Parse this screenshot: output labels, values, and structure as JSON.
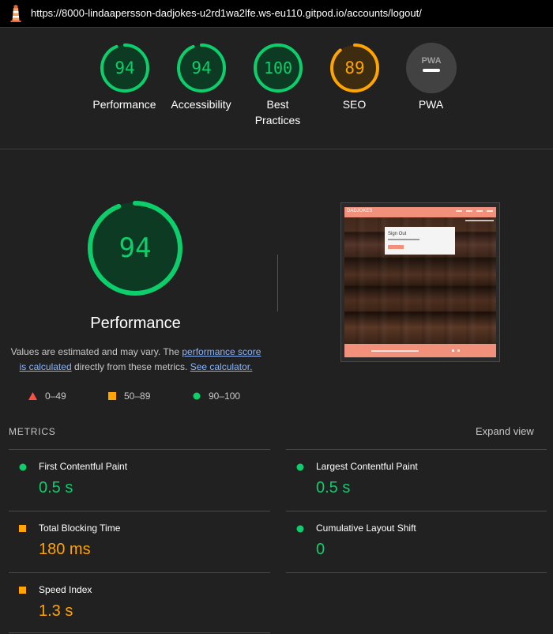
{
  "topbar": {
    "url": "https://8000-lindaapersson-dadjokes-u2rd1wa2lfe.ws-eu110.gitpod.io/accounts/logout/"
  },
  "gauges": [
    {
      "value": "94",
      "label": "Performance",
      "score": 0.94,
      "status": "pass"
    },
    {
      "value": "94",
      "label": "Accessibility",
      "score": 0.94,
      "status": "pass"
    },
    {
      "value": "100",
      "label": "Best Practices",
      "score": 1.0,
      "status": "pass"
    },
    {
      "value": "89",
      "label": "SEO",
      "score": 0.89,
      "status": "average"
    },
    {
      "value": "PWA",
      "label": "PWA",
      "status": "na"
    }
  ],
  "performance": {
    "score": "94",
    "title": "Performance",
    "desc_prefix": "Values are estimated and may vary. The ",
    "link_score": "performance score is calculated",
    "desc_middle": " directly from these metrics. ",
    "link_calc": "See calculator."
  },
  "legend": [
    {
      "range": "0–49",
      "shape": "triangle",
      "color": "#ff4e42"
    },
    {
      "range": "50–89",
      "shape": "square",
      "color": "#ffa400"
    },
    {
      "range": "90–100",
      "shape": "circle",
      "color": "#0cce6b"
    }
  ],
  "screenshot": {
    "brand": "DADJOKES",
    "card_title": "Sign Out"
  },
  "metrics": {
    "header": "METRICS",
    "expand_label": "Expand view",
    "items": [
      {
        "title": "First Contentful Paint",
        "value": "0.5 s",
        "status": "pass"
      },
      {
        "title": "Largest Contentful Paint",
        "value": "0.5 s",
        "status": "pass"
      },
      {
        "title": "Total Blocking Time",
        "value": "180 ms",
        "status": "average"
      },
      {
        "title": "Cumulative Layout Shift",
        "value": "0",
        "status": "pass"
      },
      {
        "title": "Speed Index",
        "value": "1.3 s",
        "status": "average"
      }
    ]
  },
  "colors": {
    "pass": "#0cce6b",
    "average": "#ffa400",
    "fail": "#ff4e42",
    "background": "#212121"
  }
}
